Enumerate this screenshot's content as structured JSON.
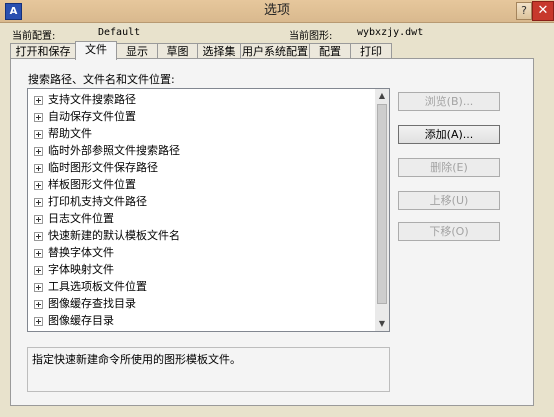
{
  "window": {
    "title": "选项",
    "app_icon": "cad-app-icon",
    "help_label": "?",
    "close_label": "✕"
  },
  "info": {
    "current_profile_label": "当前配置:",
    "current_profile_value": "Default",
    "current_drawing_label": "当前图形:",
    "current_drawing_value": "wybxzjy.dwt"
  },
  "tabs": [
    {
      "label": "打开和保存"
    },
    {
      "label": "文件"
    },
    {
      "label": "显示"
    },
    {
      "label": "草图"
    },
    {
      "label": "选择集"
    },
    {
      "label": "用户系统配置"
    },
    {
      "label": "配置"
    },
    {
      "label": "打印"
    }
  ],
  "active_tab": "文件",
  "files": {
    "section_label": "搜索路径、文件名和文件位置:",
    "items": [
      {
        "label": "支持文件搜索路径"
      },
      {
        "label": "自动保存文件位置"
      },
      {
        "label": "帮助文件"
      },
      {
        "label": "临时外部参照文件搜索路径"
      },
      {
        "label": "临时图形文件保存路径"
      },
      {
        "label": "样板图形文件位置"
      },
      {
        "label": "打印机支持文件路径"
      },
      {
        "label": "日志文件位置"
      },
      {
        "label": "快速新建的默认模板文件名"
      },
      {
        "label": "替换字体文件"
      },
      {
        "label": "字体映射文件"
      },
      {
        "label": "工具选项板文件位置"
      },
      {
        "label": "图像缓存查找目录"
      },
      {
        "label": "图像缓存目录"
      }
    ],
    "description": "指定快速新建命令所使用的图形模板文件。"
  },
  "buttons": {
    "browse": "浏览(B)...",
    "add": "添加(A)...",
    "delete": "删除(E)",
    "move_up": "上移(U)",
    "move_down": "下移(O)"
  },
  "colors": {
    "titlebar": "#e6c79c",
    "close": "#c7382c",
    "dialog_bg": "#e8e2cc"
  }
}
